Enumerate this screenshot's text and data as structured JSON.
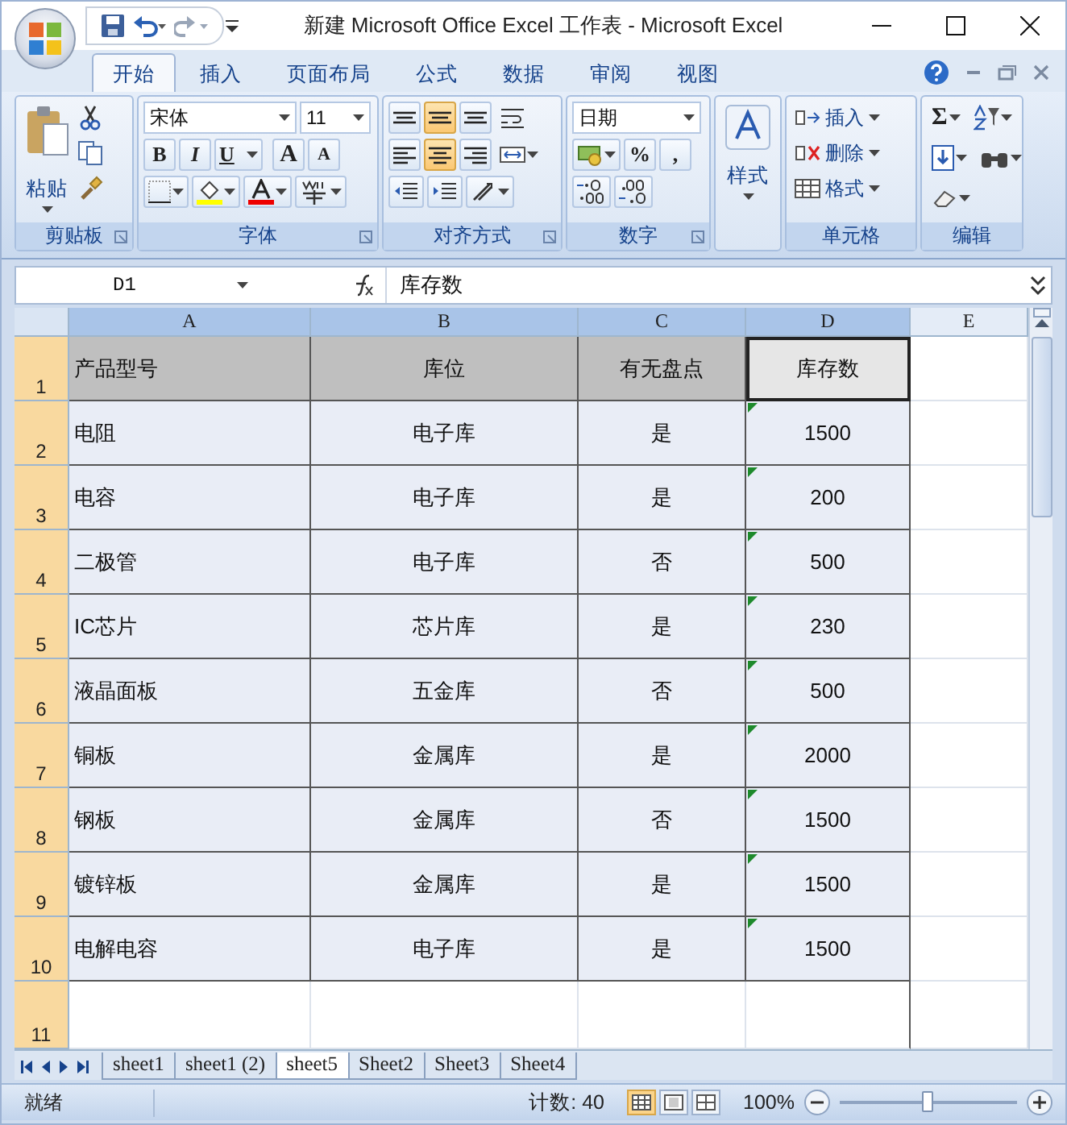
{
  "window": {
    "title": "新建 Microsoft Office Excel 工作表 - Microsoft Excel"
  },
  "ribbon_tabs": [
    {
      "label": "开始",
      "selected": true
    },
    {
      "label": "插入",
      "selected": false
    },
    {
      "label": "页面布局",
      "selected": false
    },
    {
      "label": "公式",
      "selected": false
    },
    {
      "label": "数据",
      "selected": false
    },
    {
      "label": "审阅",
      "selected": false
    },
    {
      "label": "视图",
      "selected": false
    }
  ],
  "ribbon": {
    "clipboard": {
      "label": "剪贴板",
      "paste": "粘贴"
    },
    "font": {
      "label": "字体",
      "font_name": "宋体",
      "font_size": "11",
      "bold": "B",
      "italic": "I",
      "underline": "U",
      "grow": "A",
      "shrink": "A"
    },
    "alignment": {
      "label": "对齐方式",
      "buttons": [
        {
          "kind": "top",
          "selected": false
        },
        {
          "kind": "middle",
          "selected": true
        },
        {
          "kind": "bottom",
          "selected": false
        },
        {
          "kind": "left",
          "selected": false
        },
        {
          "kind": "center",
          "selected": true
        },
        {
          "kind": "right",
          "selected": false
        }
      ]
    },
    "number": {
      "label": "数字",
      "format": "日期",
      "percent": "%",
      "comma": ","
    },
    "styles": {
      "label": "样式"
    },
    "cells": {
      "label": "单元格",
      "items": [
        "插入",
        "删除",
        "格式"
      ]
    },
    "editing": {
      "label": "编辑",
      "sum": "Σ"
    }
  },
  "formula_bar": {
    "name_box": "D1",
    "formula": "库存数"
  },
  "sheet": {
    "columns": [
      {
        "label": "A",
        "selected": true,
        "current": false
      },
      {
        "label": "B",
        "selected": true,
        "current": false
      },
      {
        "label": "C",
        "selected": true,
        "current": false
      },
      {
        "label": "D",
        "selected": true,
        "current": true
      },
      {
        "label": "E",
        "selected": false,
        "current": false
      }
    ],
    "rows": [
      {
        "label": "1",
        "selected": true,
        "current": true,
        "kind": "header",
        "warning": false,
        "cells": [
          "产品型号",
          "库位",
          "有无盘点",
          "库存数"
        ]
      },
      {
        "label": "2",
        "selected": true,
        "current": false,
        "kind": "data",
        "warning": true,
        "cells": [
          "电阻",
          "电子库",
          "是",
          "1500"
        ]
      },
      {
        "label": "3",
        "selected": true,
        "current": false,
        "kind": "data",
        "warning": true,
        "cells": [
          "电容",
          "电子库",
          "是",
          "200"
        ]
      },
      {
        "label": "4",
        "selected": true,
        "current": false,
        "kind": "data",
        "warning": true,
        "cells": [
          "二极管",
          "电子库",
          "否",
          "500"
        ]
      },
      {
        "label": "5",
        "selected": true,
        "current": false,
        "kind": "data",
        "warning": true,
        "cells": [
          "IC芯片",
          "芯片库",
          "是",
          "230"
        ]
      },
      {
        "label": "6",
        "selected": true,
        "current": false,
        "kind": "data",
        "warning": true,
        "cells": [
          "液晶面板",
          "五金库",
          "否",
          "500"
        ]
      },
      {
        "label": "7",
        "selected": true,
        "current": false,
        "kind": "data",
        "warning": true,
        "cells": [
          "铜板",
          "金属库",
          "是",
          "2000"
        ]
      },
      {
        "label": "8",
        "selected": true,
        "current": false,
        "kind": "data",
        "warning": true,
        "cells": [
          "钢板",
          "金属库",
          "否",
          "1500"
        ]
      },
      {
        "label": "9",
        "selected": true,
        "current": false,
        "kind": "data",
        "warning": true,
        "cells": [
          "镀锌板",
          "金属库",
          "是",
          "1500"
        ]
      },
      {
        "label": "10",
        "selected": true,
        "current": false,
        "kind": "data",
        "warning": true,
        "cells": [
          "电解电容",
          "电子库",
          "是",
          "1500"
        ]
      },
      {
        "label": "11",
        "selected": true,
        "current": false,
        "kind": "empty",
        "warning": false
      }
    ]
  },
  "sheet_tabs": [
    {
      "label": "sheet1",
      "selected": false
    },
    {
      "label": "sheet1 (2)",
      "selected": false
    },
    {
      "label": "sheet5",
      "selected": true
    },
    {
      "label": "Sheet2",
      "selected": false
    },
    {
      "label": "Sheet3",
      "selected": false
    },
    {
      "label": "Sheet4",
      "selected": false
    }
  ],
  "status_bar": {
    "status": "就绪",
    "count": "计数: 40",
    "views": [
      {
        "kind": "normal",
        "selected": true
      },
      {
        "kind": "layout",
        "selected": false
      },
      {
        "kind": "pagebreak",
        "selected": false
      }
    ],
    "zoom": "100%",
    "zoom_slider": {
      "level": 0.5
    }
  }
}
